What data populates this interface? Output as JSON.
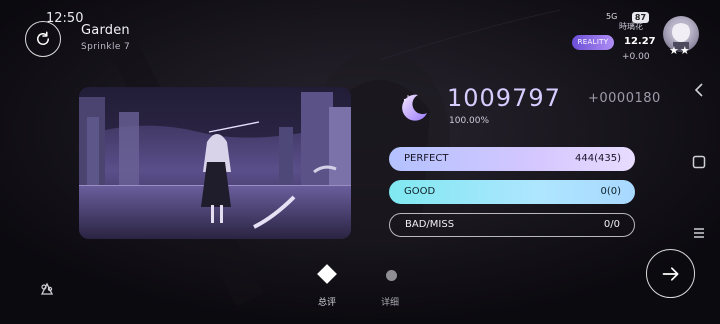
{
  "status_bar": {
    "time": "12:50",
    "network": "5G",
    "battery": "87",
    "nickname": "時璃花"
  },
  "song": {
    "title": "Garden",
    "difficulty": "Sprinkle 7"
  },
  "player": {
    "mode_badge": "REALITY",
    "rks": "12.27",
    "rks_delta": "+0.00",
    "stars": "★★"
  },
  "result": {
    "score": "1009797",
    "score_delta": "+0000180",
    "accuracy": "100.00%"
  },
  "judgements": [
    {
      "label": "PERFECT",
      "value": "444(435)",
      "color": "#c4c6ff"
    },
    {
      "label": "GOOD",
      "value": "0(0)",
      "color": "#93e6f5"
    },
    {
      "label": "BAD/MISS",
      "value": "0/0",
      "color": "#ffffff"
    }
  ],
  "tabs": [
    {
      "label": "总评",
      "active": true
    },
    {
      "label": "详细",
      "active": false
    }
  ],
  "colors": {
    "accent": "#d8ccff",
    "background": "#0b0a0f"
  },
  "icons": {
    "retry": "retry-icon",
    "next": "arrow-right-icon",
    "feedback": "feedback-icon",
    "score": "crescent-moon-icon"
  }
}
